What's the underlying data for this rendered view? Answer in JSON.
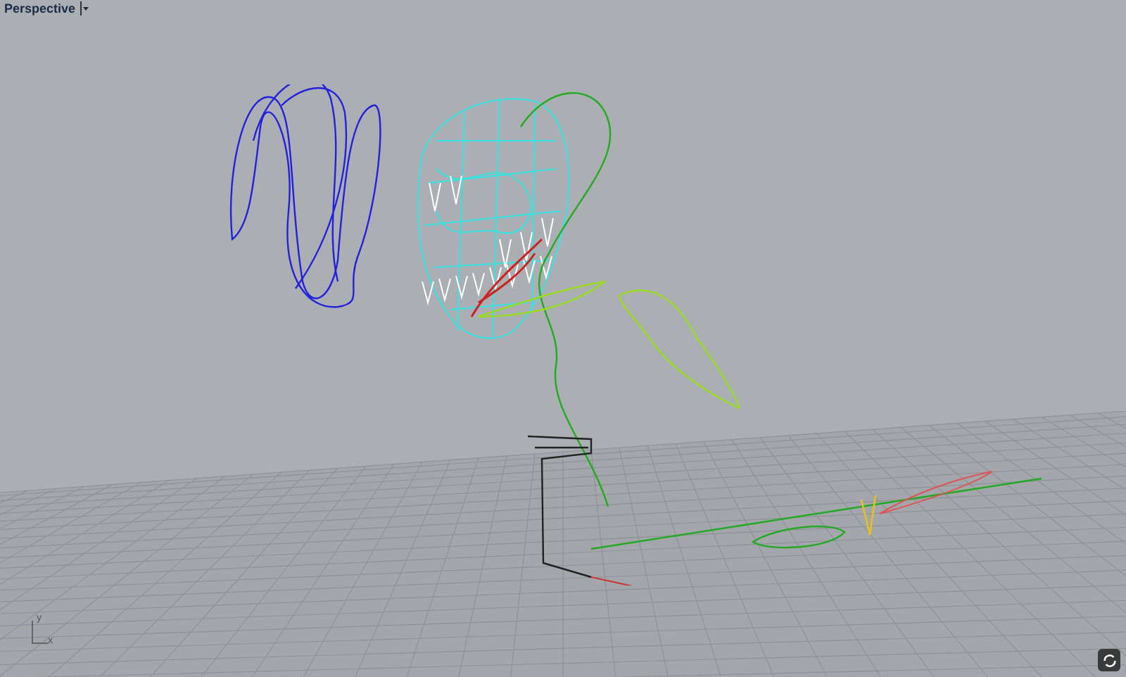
{
  "viewport": {
    "title": "Perspective"
  },
  "axis_labels": [
    "y",
    "x"
  ]
}
